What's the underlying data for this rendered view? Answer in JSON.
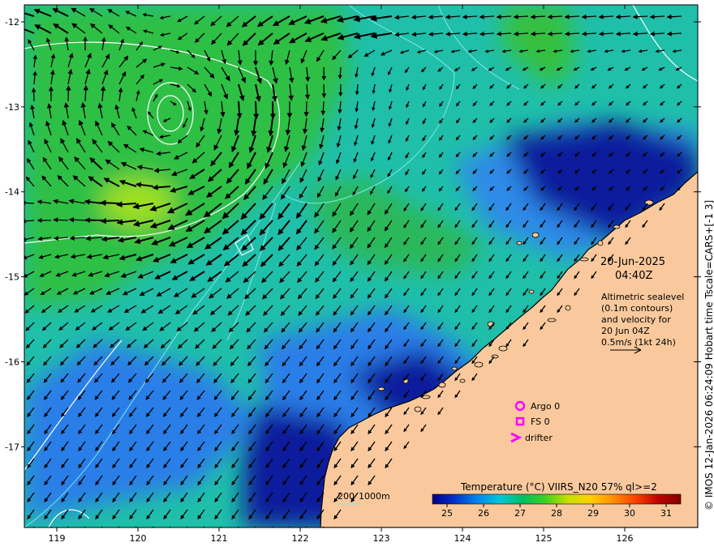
{
  "axes": {
    "lon_range": [
      118.6,
      126.9
    ],
    "lat_range": [
      -17.95,
      -11.8
    ],
    "x_ticks": [
      "119",
      "120",
      "121",
      "122",
      "123",
      "124",
      "125",
      "126"
    ],
    "y_ticks": [
      "-12",
      "-13",
      "-14",
      "-15",
      "-16",
      "-17"
    ]
  },
  "info": {
    "date": "20-Jun-2025",
    "time": "04:40Z",
    "desc": [
      "Altimetric sealevel",
      "(0.1m contours)",
      "and velocity for",
      "20 Jun 04Z",
      "0.5m/s (1kt 24h)"
    ]
  },
  "legend": {
    "argo": "Argo 0",
    "fs": "FS 0",
    "drifter": "drifter"
  },
  "depth_scale": {
    "a": "200",
    "b": "1000m"
  },
  "colorbar": {
    "title": "Temperature (°C) VIIRS_N20 57% ql>=2",
    "ticks": [
      "25",
      "26",
      "27",
      "28",
      "29",
      "30",
      "31"
    ],
    "colors": [
      "#00008b",
      "#0033cc",
      "#0088ee",
      "#00c8d8",
      "#00c060",
      "#40d020",
      "#c8e000",
      "#ffd000",
      "#ff9000",
      "#ff4000",
      "#c00000",
      "#800000"
    ]
  },
  "credit": "© IMOS 12-Jan-2026 06:24:09 Hobart time Tscale=CARS+[-1 3]",
  "colors": {
    "land": "#f9c99d",
    "coast": "#000000",
    "contour": "#ffffff",
    "isobath": "#7fe8e8",
    "legend_magenta": "#ff00ff",
    "arrow": "#000000"
  },
  "sst_regions": [
    {
      "name": "north-green",
      "color": "#2fbf45"
    },
    {
      "name": "warm-patch",
      "color": "#9ee020"
    },
    {
      "name": "mid-teal",
      "color": "#1fbfaa"
    },
    {
      "name": "cool-blue",
      "color": "#2a7ee8"
    },
    {
      "name": "coastal-dark",
      "color": "#0a1a9c"
    }
  ]
}
